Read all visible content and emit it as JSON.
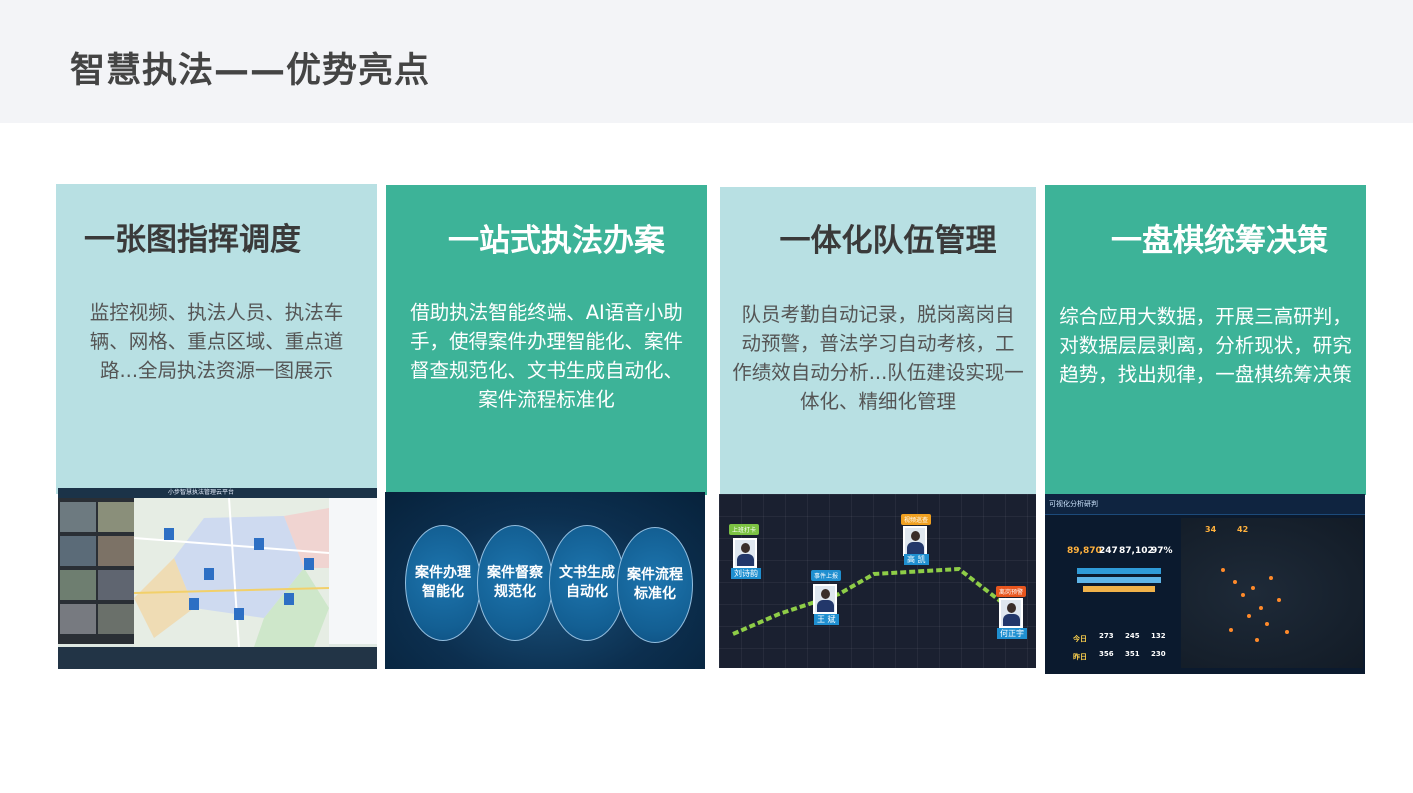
{
  "page": {
    "title": "智慧执法——优势亮点"
  },
  "cards": [
    {
      "title": "一张图指挥调度",
      "description": "监控视频、执法人员、执法车辆、网格、重点区域、重点道路...全局执法资源一图展示",
      "screenshot_title": "小步智慧执法管理云平台"
    },
    {
      "title": "一站式执法办案",
      "description": "借助执法智能终端、AI语音小助手，使得案件办理智能化、案件督查规范化、文书生成自动化、案件流程标准化",
      "circles": [
        {
          "line1": "案件办理",
          "line2": "智能化"
        },
        {
          "line1": "案件督察",
          "line2": "规范化"
        },
        {
          "line1": "文书生成",
          "line2": "自动化"
        },
        {
          "line1": "案件流程",
          "line2": "标准化"
        }
      ]
    },
    {
      "title": "一体化队伍管理",
      "description": "队员考勤自动记录，脱岗离岗自动预警，普法学习自动考核，工作绩效自动分析...队伍建设实现一体化、精细化管理",
      "people": [
        {
          "tag": "上班打卡",
          "name": "刘诗韵",
          "tag_color": "#7cc243"
        },
        {
          "tag": "事件上报",
          "name": "王 斌",
          "tag_color": "#1f8fd0"
        },
        {
          "tag": "视频巡查",
          "name": "高 凯",
          "tag_color": "#f0a020"
        },
        {
          "tag": "离岗预警",
          "name": "何正宇",
          "tag_color": "#e8561e"
        }
      ]
    },
    {
      "title": "一盘棋统筹决策",
      "description": "综合应用大数据，开展三高研判，对数据层层剥离，分析现状，研究趋势，找出规律，一盘棋统筹决策",
      "dashboard": {
        "title": "可视化分析研判",
        "stats": [
          "89,870",
          "247",
          "87,102",
          "97%"
        ],
        "counters": [
          "34",
          "42"
        ],
        "today_label": "今日",
        "yesterday_label": "昨日",
        "today_values": [
          "273",
          "245",
          "132"
        ],
        "yesterday_values": [
          "356",
          "351",
          "230"
        ]
      }
    }
  ]
}
